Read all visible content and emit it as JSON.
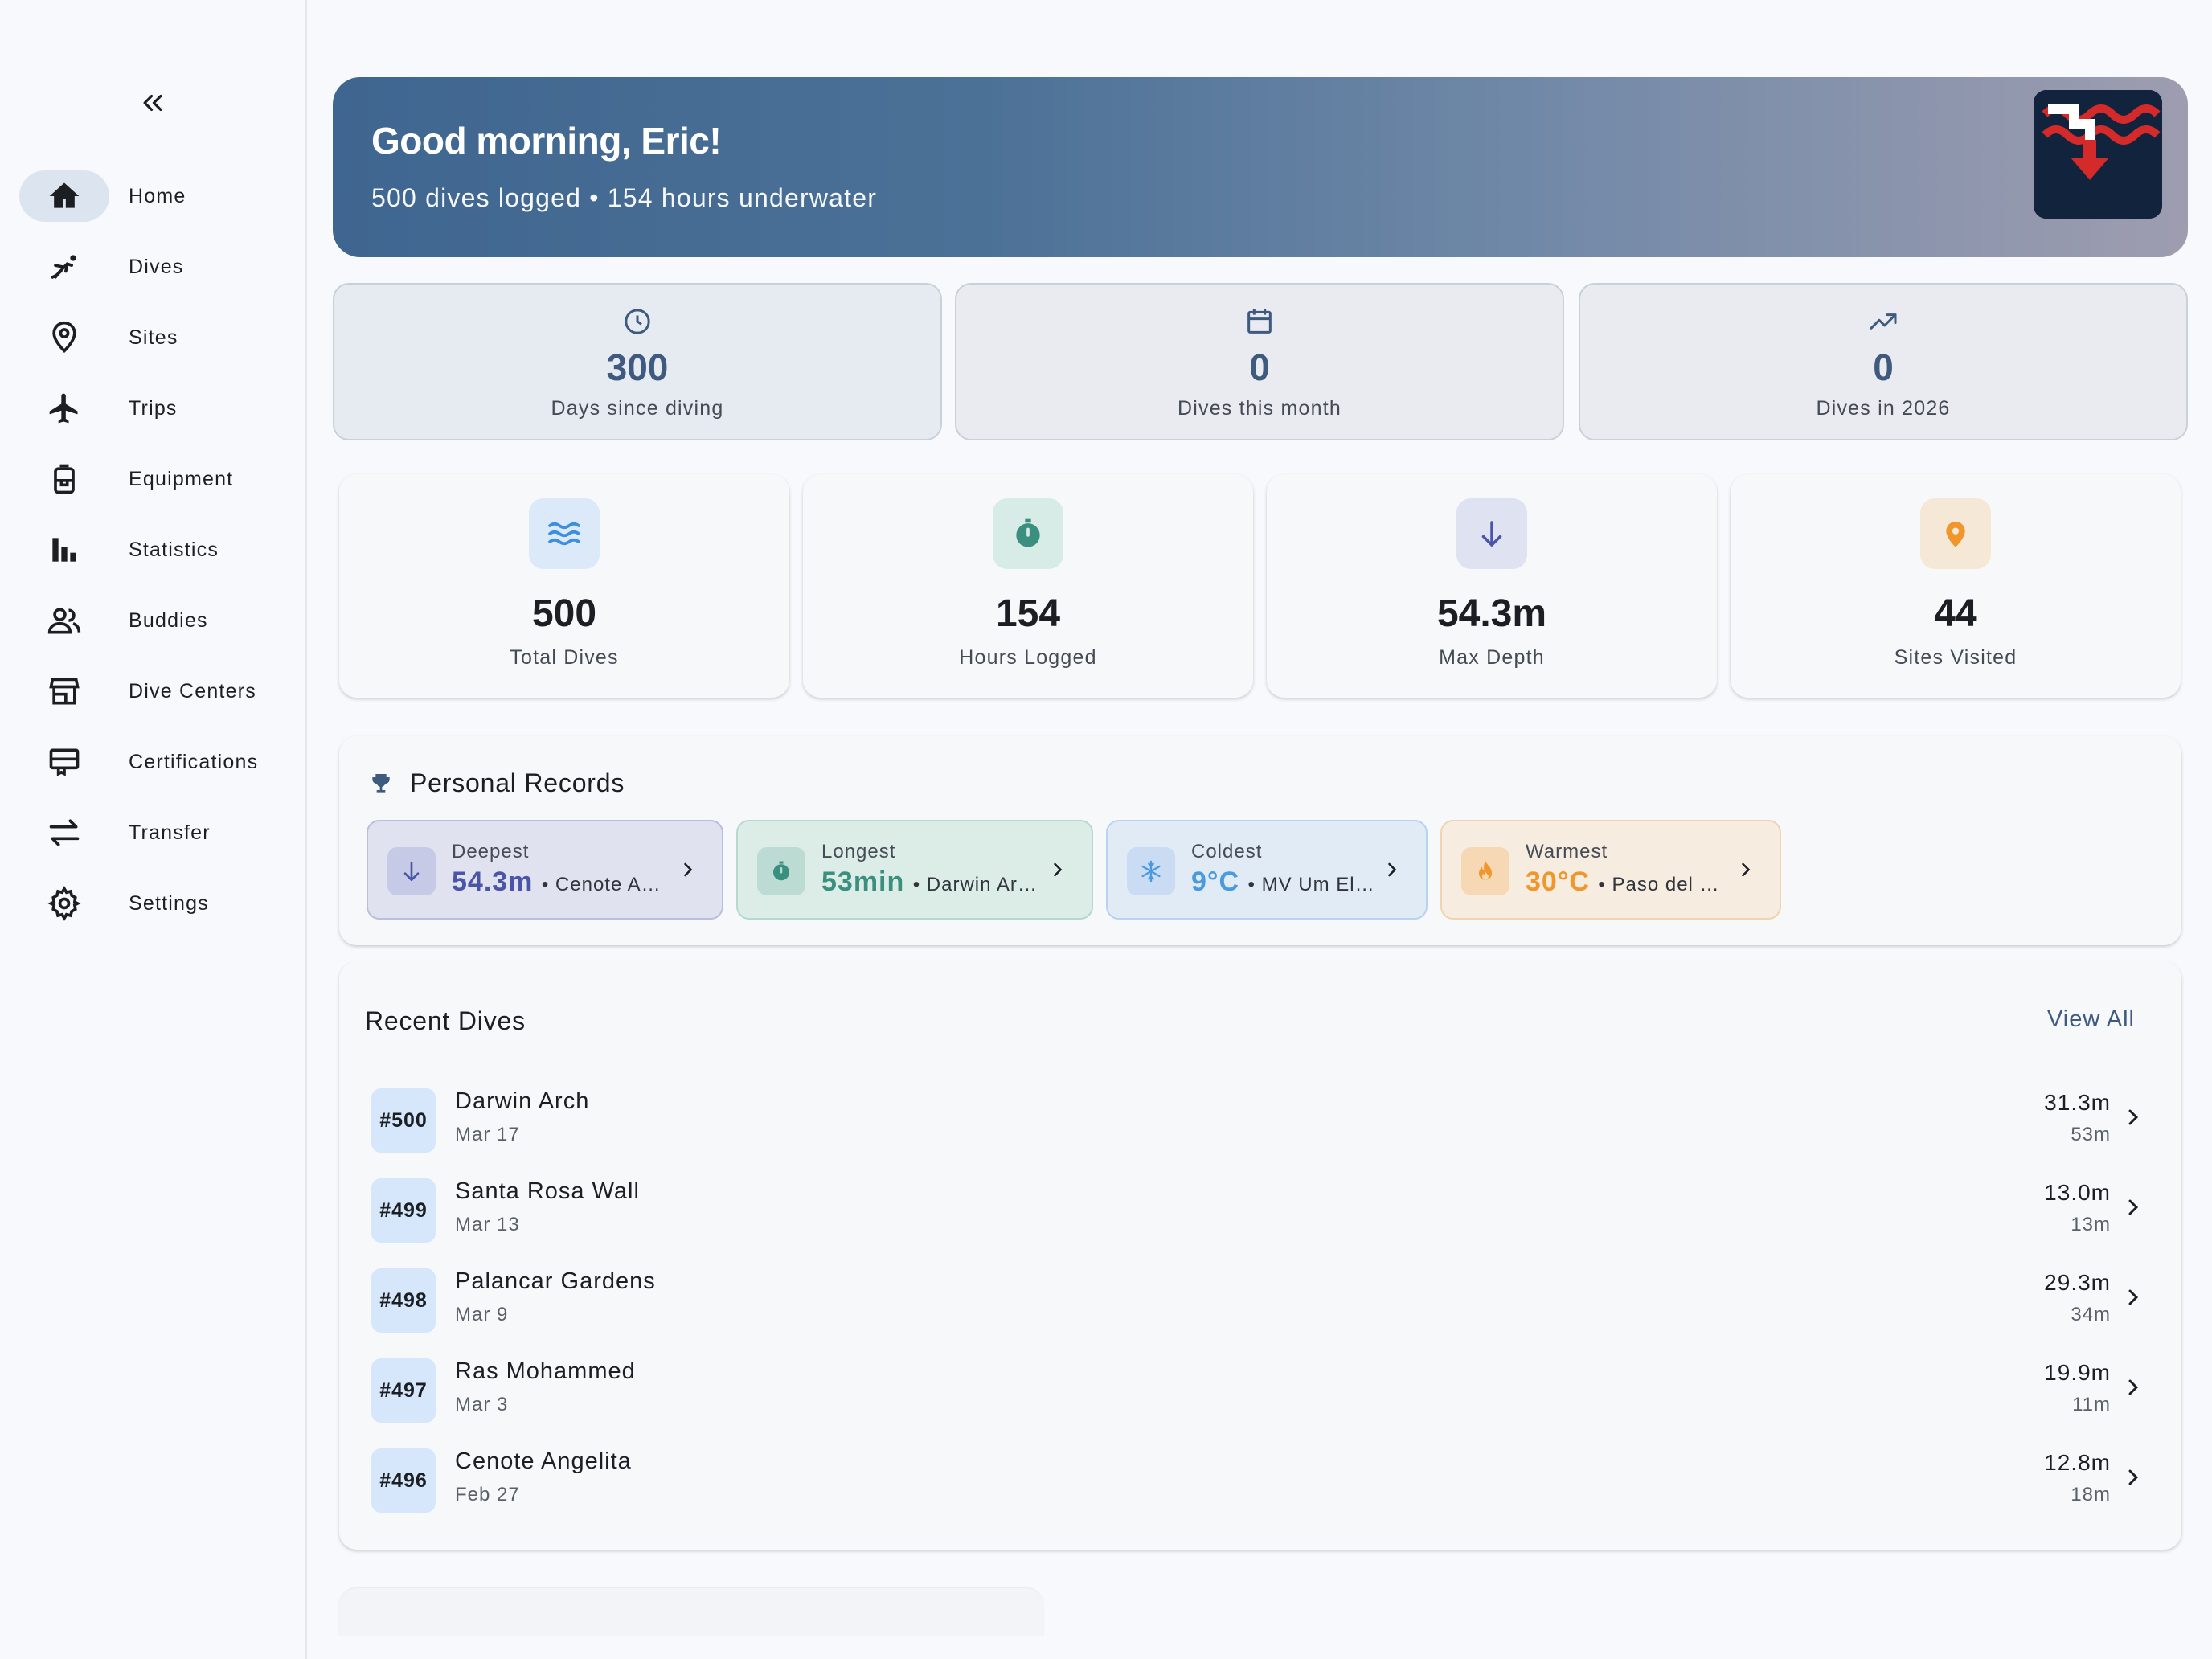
{
  "colors": {
    "accent": "#3e5a7e",
    "hero_start": "#3f6690",
    "hero_end": "#9e9db0",
    "deepest": "#4a55a8",
    "longest": "#3a8f7f",
    "coldest": "#4a9ae0",
    "warmest": "#f0962a"
  },
  "sidebar": {
    "collapse_icon": "double-chevron-left-icon",
    "items": [
      {
        "label": "Home",
        "icon": "home-icon",
        "active": true
      },
      {
        "label": "Dives",
        "icon": "diver-icon"
      },
      {
        "label": "Sites",
        "icon": "location-pin-icon"
      },
      {
        "label": "Trips",
        "icon": "airplane-icon"
      },
      {
        "label": "Equipment",
        "icon": "tank-icon"
      },
      {
        "label": "Statistics",
        "icon": "bar-chart-icon"
      },
      {
        "label": "Buddies",
        "icon": "people-icon"
      },
      {
        "label": "Dive Centers",
        "icon": "store-icon"
      },
      {
        "label": "Certifications",
        "icon": "card-icon"
      },
      {
        "label": "Transfer",
        "icon": "swap-icon"
      },
      {
        "label": "Settings",
        "icon": "gear-icon"
      }
    ]
  },
  "hero": {
    "greeting": "Good morning, Eric!",
    "subtitle": "500 dives logged • 154 hours underwater"
  },
  "stats": [
    {
      "value": "300",
      "label": "Days since diving",
      "icon": "clock-icon"
    },
    {
      "value": "0",
      "label": "Dives this month",
      "icon": "calendar-icon"
    },
    {
      "value": "0",
      "label": "Dives in 2026",
      "icon": "trending-up-icon"
    }
  ],
  "kpis": [
    {
      "value": "500",
      "label": "Total Dives",
      "icon": "waves-icon"
    },
    {
      "value": "154",
      "label": "Hours Logged",
      "icon": "stopwatch-icon"
    },
    {
      "value": "54.3m",
      "label": "Max Depth",
      "icon": "arrow-down-icon"
    },
    {
      "value": "44",
      "label": "Sites Visited",
      "icon": "location-pin-icon"
    }
  ],
  "records": {
    "title": "Personal Records",
    "items": [
      {
        "label": "Deepest",
        "value": "54.3m",
        "site": "• Cenote A…",
        "icon": "arrow-down-icon"
      },
      {
        "label": "Longest",
        "value": "53min",
        "site": "• Darwin Ar…",
        "icon": "stopwatch-icon"
      },
      {
        "label": "Coldest",
        "value": "9°C",
        "site": "• MV Um El…",
        "icon": "snowflake-icon"
      },
      {
        "label": "Warmest",
        "value": "30°C",
        "site": "• Paso del …",
        "icon": "flame-icon"
      }
    ]
  },
  "recent": {
    "title": "Recent Dives",
    "view_all": "View All",
    "dives": [
      {
        "num": "#500",
        "site": "Darwin Arch",
        "date": "Mar 17",
        "depth": "31.3m",
        "duration": "53m"
      },
      {
        "num": "#499",
        "site": "Santa Rosa Wall",
        "date": "Mar 13",
        "depth": "13.0m",
        "duration": "13m"
      },
      {
        "num": "#498",
        "site": "Palancar Gardens",
        "date": "Mar 9",
        "depth": "29.3m",
        "duration": "34m"
      },
      {
        "num": "#497",
        "site": "Ras Mohammed",
        "date": "Mar 3",
        "depth": "19.9m",
        "duration": "11m"
      },
      {
        "num": "#496",
        "site": "Cenote Angelita",
        "date": "Feb 27",
        "depth": "12.8m",
        "duration": "18m"
      }
    ]
  }
}
